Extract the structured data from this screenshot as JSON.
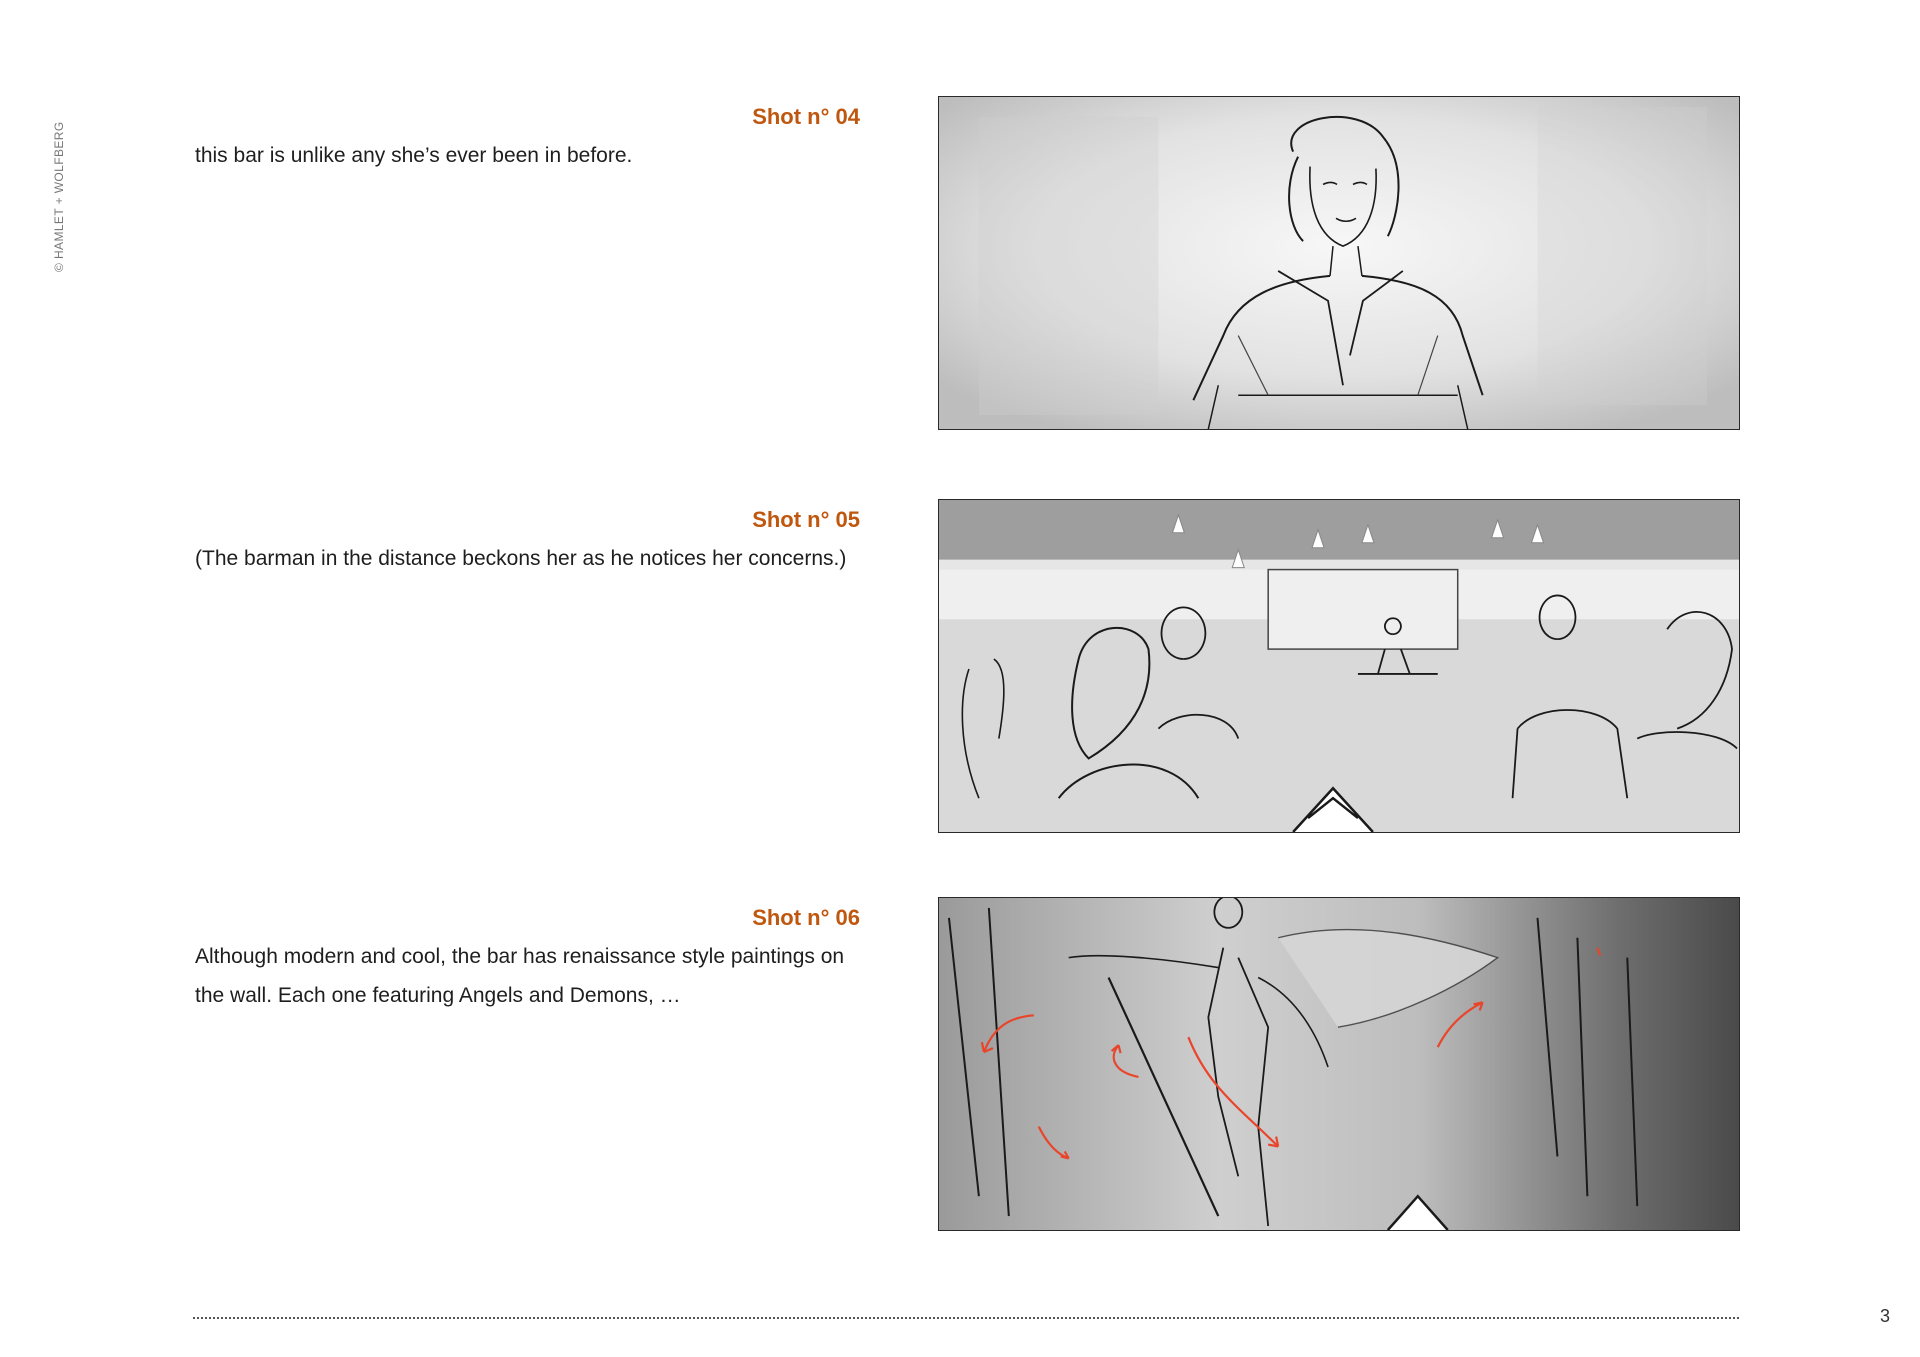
{
  "copyright": "© HAMLET + WOLFBERG",
  "shots": [
    {
      "title": "Shot n° 04",
      "text": "this bar is unlike any she’s ever been in before."
    },
    {
      "title": "Shot n° 05",
      "text": "(The barman in the distance beckons her as he notices her concerns.)"
    },
    {
      "title": "Shot n° 06",
      "text": "Although modern and cool, the bar has renaissance style paintings on the wall. Each one featuring Angels and Demons, …"
    }
  ],
  "page_number": "3",
  "colors": {
    "shot_title": "#c0570f",
    "motion_arrow": "#e8452a",
    "sketch_line": "#1a1a1a"
  }
}
